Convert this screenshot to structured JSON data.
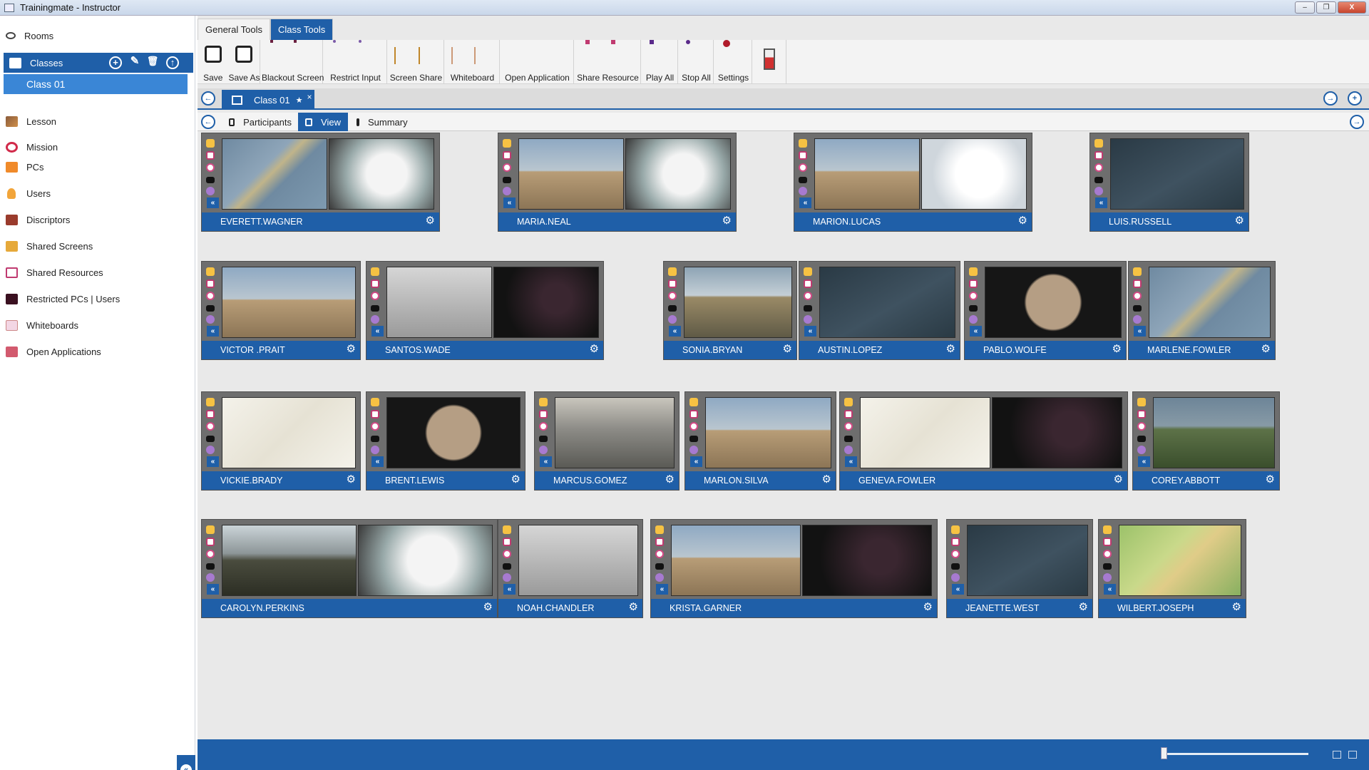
{
  "window": {
    "title": "Trainingmate - Instructor",
    "controls": [
      "–",
      "❐",
      "X"
    ]
  },
  "sidebar": {
    "rooms": "Rooms",
    "classes": "Classes",
    "class_item": "Class 01",
    "items": [
      "Lesson",
      "Mission",
      "PCs",
      "Users",
      "Discriptors",
      "Shared Screens",
      "Shared Resources",
      "Restricted PCs | Users",
      "Whiteboards",
      "Open Applications"
    ],
    "class_actions": [
      "+",
      "✎",
      "🗑",
      "↑"
    ],
    "collapse": "«"
  },
  "ribbon": {
    "tabs": [
      "General Tools",
      "Class Tools"
    ],
    "active_tab": "Class Tools",
    "groups": [
      {
        "label": "Save"
      },
      {
        "label": "Save As"
      },
      {
        "label": "Blackout Screen"
      },
      {
        "label": "Restrict Input"
      },
      {
        "label": "Screen Share"
      },
      {
        "label": "Whiteboard"
      },
      {
        "label": "Open Application"
      },
      {
        "label": "Share Resource"
      },
      {
        "label": "Play All"
      },
      {
        "label": "Stop All"
      },
      {
        "label": "Settings"
      }
    ]
  },
  "doc_tab": {
    "label": "Class 01",
    "marker": "★",
    "close": "×"
  },
  "view_tabs": [
    "Participants",
    "View",
    "Summary"
  ],
  "active_view_tab": "View",
  "nav": {
    "back": "←",
    "forward": "→",
    "add": "+"
  },
  "participants": [
    "EVERETT.WAGNER",
    "MARIA.NEAL",
    "MARION.LUCAS",
    "LUIS.RUSSELL",
    "VICTOR .PRAIT",
    "SANTOS.WADE",
    "SONIA.BRYAN",
    "AUSTIN.LOPEZ",
    "PABLO.WOLFE",
    "MARLENE.FOWLER",
    "VICKIE.BRADY",
    "BRENT.LEWIS",
    "MARCUS.GOMEZ",
    "MARLON.SILVA",
    "GENEVA.FOWLER",
    "COREY.ABBOTT",
    "CAROLYN.PERKINS",
    "NOAH.CHANDLER",
    "KRISTA.GARNER",
    "JEANETTE.WEST",
    "WILBERT.JOSEPH"
  ],
  "card_icons": {
    "expand": "«",
    "settings": "⚙"
  },
  "colors": {
    "accent": "#1f5fa8",
    "accent_light": "#3a86d6",
    "card": "#6e6e6e"
  }
}
